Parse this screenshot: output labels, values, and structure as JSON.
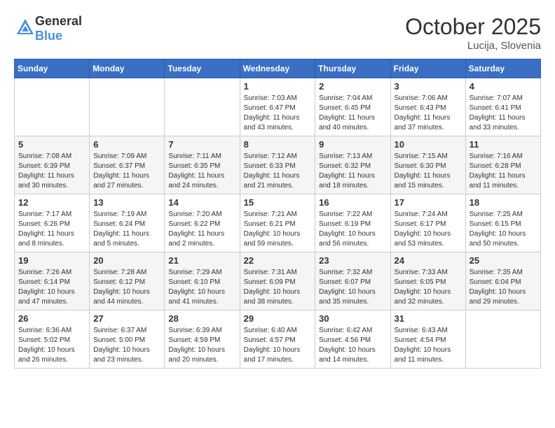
{
  "header": {
    "logo_general": "General",
    "logo_blue": "Blue",
    "month_year": "October 2025",
    "location": "Lucija, Slovenia"
  },
  "weekdays": [
    "Sunday",
    "Monday",
    "Tuesday",
    "Wednesday",
    "Thursday",
    "Friday",
    "Saturday"
  ],
  "weeks": [
    [
      {
        "day": "",
        "info": ""
      },
      {
        "day": "",
        "info": ""
      },
      {
        "day": "",
        "info": ""
      },
      {
        "day": "1",
        "info": "Sunrise: 7:03 AM\nSunset: 6:47 PM\nDaylight: 11 hours\nand 43 minutes."
      },
      {
        "day": "2",
        "info": "Sunrise: 7:04 AM\nSunset: 6:45 PM\nDaylight: 11 hours\nand 40 minutes."
      },
      {
        "day": "3",
        "info": "Sunrise: 7:06 AM\nSunset: 6:43 PM\nDaylight: 11 hours\nand 37 minutes."
      },
      {
        "day": "4",
        "info": "Sunrise: 7:07 AM\nSunset: 6:41 PM\nDaylight: 11 hours\nand 33 minutes."
      }
    ],
    [
      {
        "day": "5",
        "info": "Sunrise: 7:08 AM\nSunset: 6:39 PM\nDaylight: 11 hours\nand 30 minutes."
      },
      {
        "day": "6",
        "info": "Sunrise: 7:09 AM\nSunset: 6:37 PM\nDaylight: 11 hours\nand 27 minutes."
      },
      {
        "day": "7",
        "info": "Sunrise: 7:11 AM\nSunset: 6:35 PM\nDaylight: 11 hours\nand 24 minutes."
      },
      {
        "day": "8",
        "info": "Sunrise: 7:12 AM\nSunset: 6:33 PM\nDaylight: 11 hours\nand 21 minutes."
      },
      {
        "day": "9",
        "info": "Sunrise: 7:13 AM\nSunset: 6:32 PM\nDaylight: 11 hours\nand 18 minutes."
      },
      {
        "day": "10",
        "info": "Sunrise: 7:15 AM\nSunset: 6:30 PM\nDaylight: 11 hours\nand 15 minutes."
      },
      {
        "day": "11",
        "info": "Sunrise: 7:16 AM\nSunset: 6:28 PM\nDaylight: 11 hours\nand 11 minutes."
      }
    ],
    [
      {
        "day": "12",
        "info": "Sunrise: 7:17 AM\nSunset: 6:26 PM\nDaylight: 11 hours\nand 8 minutes."
      },
      {
        "day": "13",
        "info": "Sunrise: 7:19 AM\nSunset: 6:24 PM\nDaylight: 11 hours\nand 5 minutes."
      },
      {
        "day": "14",
        "info": "Sunrise: 7:20 AM\nSunset: 6:22 PM\nDaylight: 11 hours\nand 2 minutes."
      },
      {
        "day": "15",
        "info": "Sunrise: 7:21 AM\nSunset: 6:21 PM\nDaylight: 10 hours\nand 59 minutes."
      },
      {
        "day": "16",
        "info": "Sunrise: 7:22 AM\nSunset: 6:19 PM\nDaylight: 10 hours\nand 56 minutes."
      },
      {
        "day": "17",
        "info": "Sunrise: 7:24 AM\nSunset: 6:17 PM\nDaylight: 10 hours\nand 53 minutes."
      },
      {
        "day": "18",
        "info": "Sunrise: 7:25 AM\nSunset: 6:15 PM\nDaylight: 10 hours\nand 50 minutes."
      }
    ],
    [
      {
        "day": "19",
        "info": "Sunrise: 7:26 AM\nSunset: 6:14 PM\nDaylight: 10 hours\nand 47 minutes."
      },
      {
        "day": "20",
        "info": "Sunrise: 7:28 AM\nSunset: 6:12 PM\nDaylight: 10 hours\nand 44 minutes."
      },
      {
        "day": "21",
        "info": "Sunrise: 7:29 AM\nSunset: 6:10 PM\nDaylight: 10 hours\nand 41 minutes."
      },
      {
        "day": "22",
        "info": "Sunrise: 7:31 AM\nSunset: 6:09 PM\nDaylight: 10 hours\nand 38 minutes."
      },
      {
        "day": "23",
        "info": "Sunrise: 7:32 AM\nSunset: 6:07 PM\nDaylight: 10 hours\nand 35 minutes."
      },
      {
        "day": "24",
        "info": "Sunrise: 7:33 AM\nSunset: 6:05 PM\nDaylight: 10 hours\nand 32 minutes."
      },
      {
        "day": "25",
        "info": "Sunrise: 7:35 AM\nSunset: 6:04 PM\nDaylight: 10 hours\nand 29 minutes."
      }
    ],
    [
      {
        "day": "26",
        "info": "Sunrise: 6:36 AM\nSunset: 5:02 PM\nDaylight: 10 hours\nand 26 minutes."
      },
      {
        "day": "27",
        "info": "Sunrise: 6:37 AM\nSunset: 5:00 PM\nDaylight: 10 hours\nand 23 minutes."
      },
      {
        "day": "28",
        "info": "Sunrise: 6:39 AM\nSunset: 4:59 PM\nDaylight: 10 hours\nand 20 minutes."
      },
      {
        "day": "29",
        "info": "Sunrise: 6:40 AM\nSunset: 4:57 PM\nDaylight: 10 hours\nand 17 minutes."
      },
      {
        "day": "30",
        "info": "Sunrise: 6:42 AM\nSunset: 4:56 PM\nDaylight: 10 hours\nand 14 minutes."
      },
      {
        "day": "31",
        "info": "Sunrise: 6:43 AM\nSunset: 4:54 PM\nDaylight: 10 hours\nand 11 minutes."
      },
      {
        "day": "",
        "info": ""
      }
    ]
  ]
}
